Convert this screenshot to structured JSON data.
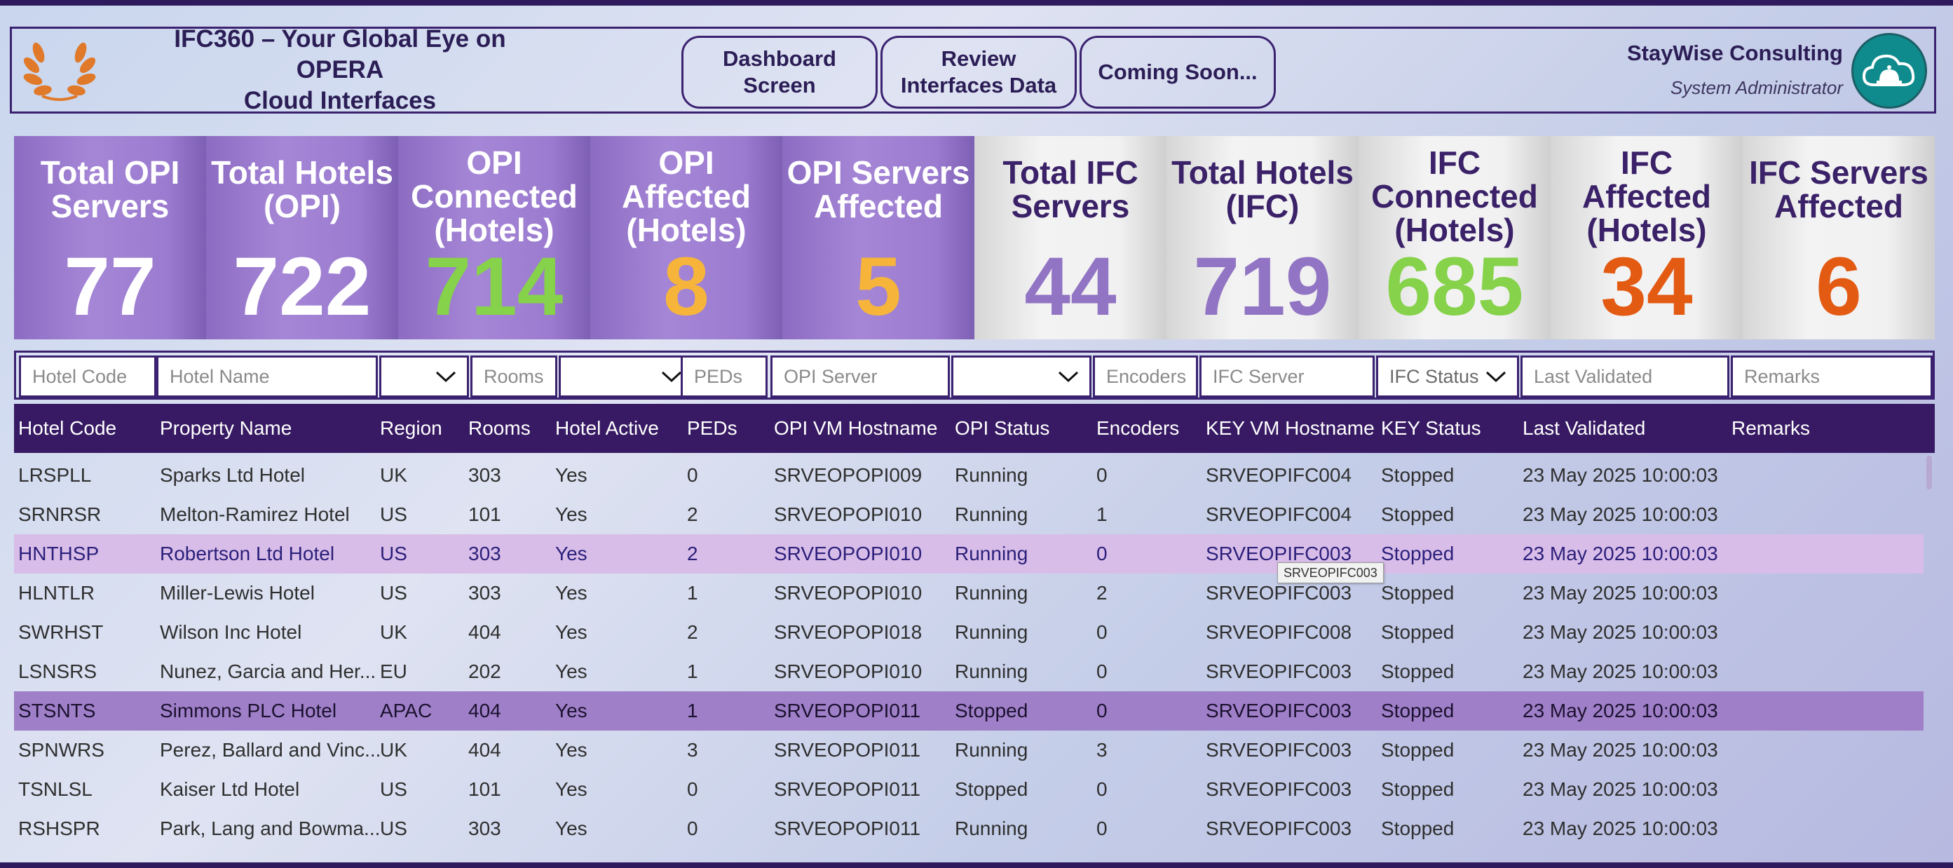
{
  "header": {
    "title_line1": "IFC360 – Your Global Eye on OPERA",
    "title_line2": "Cloud Interfaces",
    "nav": [
      {
        "label": "Dashboard Screen"
      },
      {
        "label": "Review Interfaces Data"
      },
      {
        "label": "Coming Soon..."
      }
    ],
    "company": "StayWise Consulting",
    "role": "System Administrator",
    "logo_icon": "laurel-wreath-icon",
    "avatar_icon": "cloud-service-bell-icon"
  },
  "colors": {
    "opi_tile": "#9b7bcf",
    "ifc_tile": "#f1f1f1",
    "purple_value": "#9274c4",
    "green_value": "#86d24a",
    "amber_value": "#f6b53a",
    "orange_value": "#e35a12",
    "header_bg": "#371a63"
  },
  "kpis": [
    {
      "line1": "Total OPI",
      "line2": "Servers",
      "line3": "",
      "value": "77",
      "group": "opi",
      "value_color": "#ffffff"
    },
    {
      "line1": "Total Hotels",
      "line2": "(OPI)",
      "line3": "",
      "value": "722",
      "group": "opi",
      "value_color": "#ffffff"
    },
    {
      "line1": "OPI",
      "line2": "Connected",
      "line3": "(Hotels)",
      "value": "714",
      "group": "opi",
      "value_color": "#86d24a"
    },
    {
      "line1": "OPI",
      "line2": "Affected",
      "line3": "(Hotels)",
      "value": "8",
      "group": "opi",
      "value_color": "#f6b53a"
    },
    {
      "line1": "OPI Servers",
      "line2": "Affected",
      "line3": "",
      "value": "5",
      "group": "opi",
      "value_color": "#f6b53a"
    },
    {
      "line1": "Total IFC",
      "line2": "Servers",
      "line3": "",
      "value": "44",
      "group": "ifc",
      "value_color": "#9274c4"
    },
    {
      "line1": "Total Hotels",
      "line2": "(IFC)",
      "line3": "",
      "value": "719",
      "group": "ifc",
      "value_color": "#9274c4"
    },
    {
      "line1": "IFC",
      "line2": "Connected",
      "line3": "(Hotels)",
      "value": "685",
      "group": "ifc",
      "value_color": "#86d24a"
    },
    {
      "line1": "IFC",
      "line2": "Affected",
      "line3": "(Hotels)",
      "value": "34",
      "group": "ifc",
      "value_color": "#e35a12"
    },
    {
      "line1": "IFC Servers",
      "line2": "Affected",
      "line3": "",
      "value": "6",
      "group": "ifc",
      "value_color": "#e35a12"
    }
  ],
  "filters": [
    {
      "name": "hotel-code-filter",
      "placeholder": "Hotel Code",
      "type": "text"
    },
    {
      "name": "hotel-name-filter",
      "placeholder": "Hotel Name",
      "type": "text"
    },
    {
      "name": "region-filter",
      "placeholder": "",
      "type": "dropdown"
    },
    {
      "name": "rooms-filter",
      "placeholder": "Rooms",
      "type": "text"
    },
    {
      "name": "hotel-active-filter",
      "placeholder": "",
      "type": "dropdown"
    },
    {
      "name": "peds-filter",
      "placeholder": "PEDs",
      "type": "text"
    },
    {
      "name": "opi-server-filter",
      "placeholder": "OPI Server",
      "type": "text"
    },
    {
      "name": "opi-status-filter",
      "placeholder": "",
      "type": "dropdown"
    },
    {
      "name": "encoders-filter",
      "placeholder": "Encoders",
      "type": "text"
    },
    {
      "name": "ifc-server-filter",
      "placeholder": "IFC Server",
      "type": "text"
    },
    {
      "name": "ifc-status-filter",
      "placeholder": "IFC Status",
      "type": "dropdown"
    },
    {
      "name": "last-validated-filter",
      "placeholder": "Last Validated",
      "type": "text"
    },
    {
      "name": "remarks-filter",
      "placeholder": "Remarks",
      "type": "text"
    }
  ],
  "table": {
    "columns": [
      "Hotel Code",
      "Property Name",
      "Region",
      "Rooms",
      "Hotel Active",
      "PEDs",
      "OPI VM Hostname",
      "OPI Status",
      "Encoders",
      "KEY VM Hostname",
      "KEY Status",
      "Last Validated",
      "Remarks"
    ],
    "rows": [
      [
        "LRSPLL",
        "Sparks Ltd Hotel",
        "UK",
        "303",
        "Yes",
        "0",
        "SRVEOPOPI009",
        "Running",
        "0",
        "SRVEOPIFC004",
        "Stopped",
        "23 May 2025 10:00:03",
        ""
      ],
      [
        "SRNRSR",
        "Melton-Ramirez Hotel",
        "US",
        "101",
        "Yes",
        "2",
        "SRVEOPOPI010",
        "Running",
        "1",
        "SRVEOPIFC004",
        "Stopped",
        "23 May 2025 10:00:03",
        ""
      ],
      [
        "HNTHSP",
        "Robertson Ltd Hotel",
        "US",
        "303",
        "Yes",
        "2",
        "SRVEOPOPI010",
        "Running",
        "0",
        "SRVEOPIFC003",
        "Stopped",
        "23 May 2025 10:00:03",
        ""
      ],
      [
        "HLNTLR",
        "Miller-Lewis Hotel",
        "US",
        "303",
        "Yes",
        "1",
        "SRVEOPOPI010",
        "Running",
        "2",
        "SRVEOPIFC003",
        "Stopped",
        "23 May 2025 10:00:03",
        ""
      ],
      [
        "SWRHST",
        "Wilson Inc Hotel",
        "UK",
        "404",
        "Yes",
        "2",
        "SRVEOPOPI018",
        "Running",
        "0",
        "SRVEOPIFC008",
        "Stopped",
        "23 May 2025 10:00:03",
        ""
      ],
      [
        "LSNSRS",
        "Nunez, Garcia and Her...",
        "EU",
        "202",
        "Yes",
        "1",
        "SRVEOPOPI010",
        "Running",
        "0",
        "SRVEOPIFC003",
        "Stopped",
        "23 May 2025 10:00:03",
        ""
      ],
      [
        "STSNTS",
        "Simmons PLC Hotel",
        "APAC",
        "404",
        "Yes",
        "1",
        "SRVEOPOPI011",
        "Stopped",
        "0",
        "SRVEOPIFC003",
        "Stopped",
        "23 May 2025 10:00:03",
        ""
      ],
      [
        "SPNWRS",
        "Perez, Ballard and Vinc...",
        "UK",
        "404",
        "Yes",
        "3",
        "SRVEOPOPI011",
        "Running",
        "3",
        "SRVEOPIFC003",
        "Stopped",
        "23 May 2025 10:00:03",
        ""
      ],
      [
        "TSNLSL",
        "Kaiser Ltd Hotel",
        "US",
        "101",
        "Yes",
        "0",
        "SRVEOPOPI011",
        "Stopped",
        "0",
        "SRVEOPIFC003",
        "Stopped",
        "23 May 2025 10:00:03",
        ""
      ],
      [
        "RSHSPR",
        "Park, Lang and Bowma...",
        "US",
        "303",
        "Yes",
        "0",
        "SRVEOPOPI011",
        "Running",
        "0",
        "SRVEOPIFC003",
        "Stopped",
        "23 May 2025 10:00:03",
        ""
      ]
    ],
    "hover_row": 2,
    "selected_row": 6
  },
  "tooltip": {
    "text": "SRVEOPIFC003"
  }
}
